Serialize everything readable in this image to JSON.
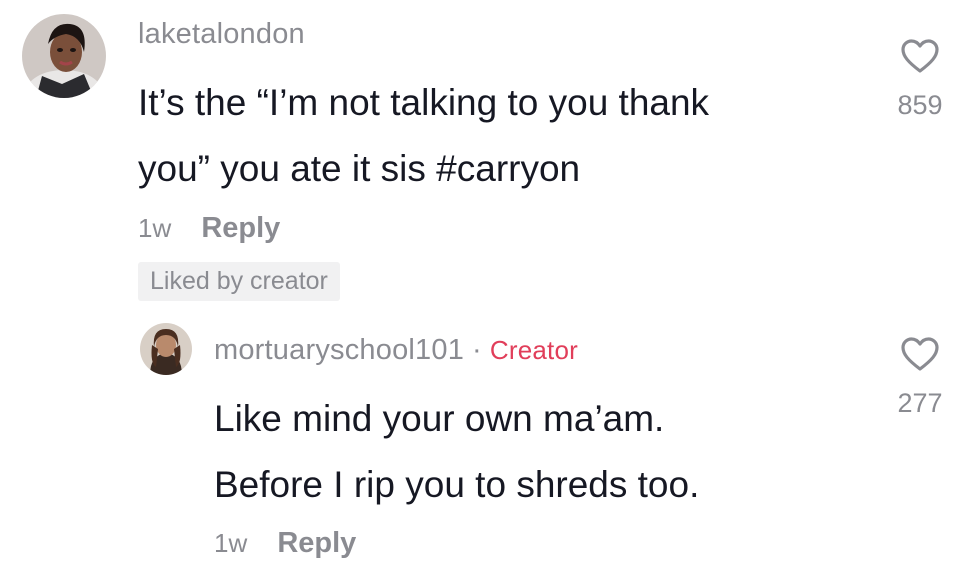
{
  "comments": [
    {
      "username": "laketalondon",
      "text_line1": "It’s the “I’m not talking to you thank",
      "text_line2": "you” you ate it sis #carryon",
      "time": "1w",
      "reply_label": "Reply",
      "liked_badge": "Liked by creator",
      "like_count": "859"
    }
  ],
  "reply": {
    "username": "mortuaryschool101",
    "separator": "·",
    "creator_label": "Creator",
    "text_line1": "Like mind your own ma’am.",
    "text_line2": "Before I rip you to shreds too.",
    "time": "1w",
    "reply_label": "Reply",
    "like_count": "277"
  },
  "colors": {
    "creator_accent": "#e13e5a",
    "muted_text": "#8a8b91",
    "body_text": "#161823",
    "badge_bg": "#f1f1f2"
  },
  "icons": {
    "like": "heart-outline-icon"
  }
}
